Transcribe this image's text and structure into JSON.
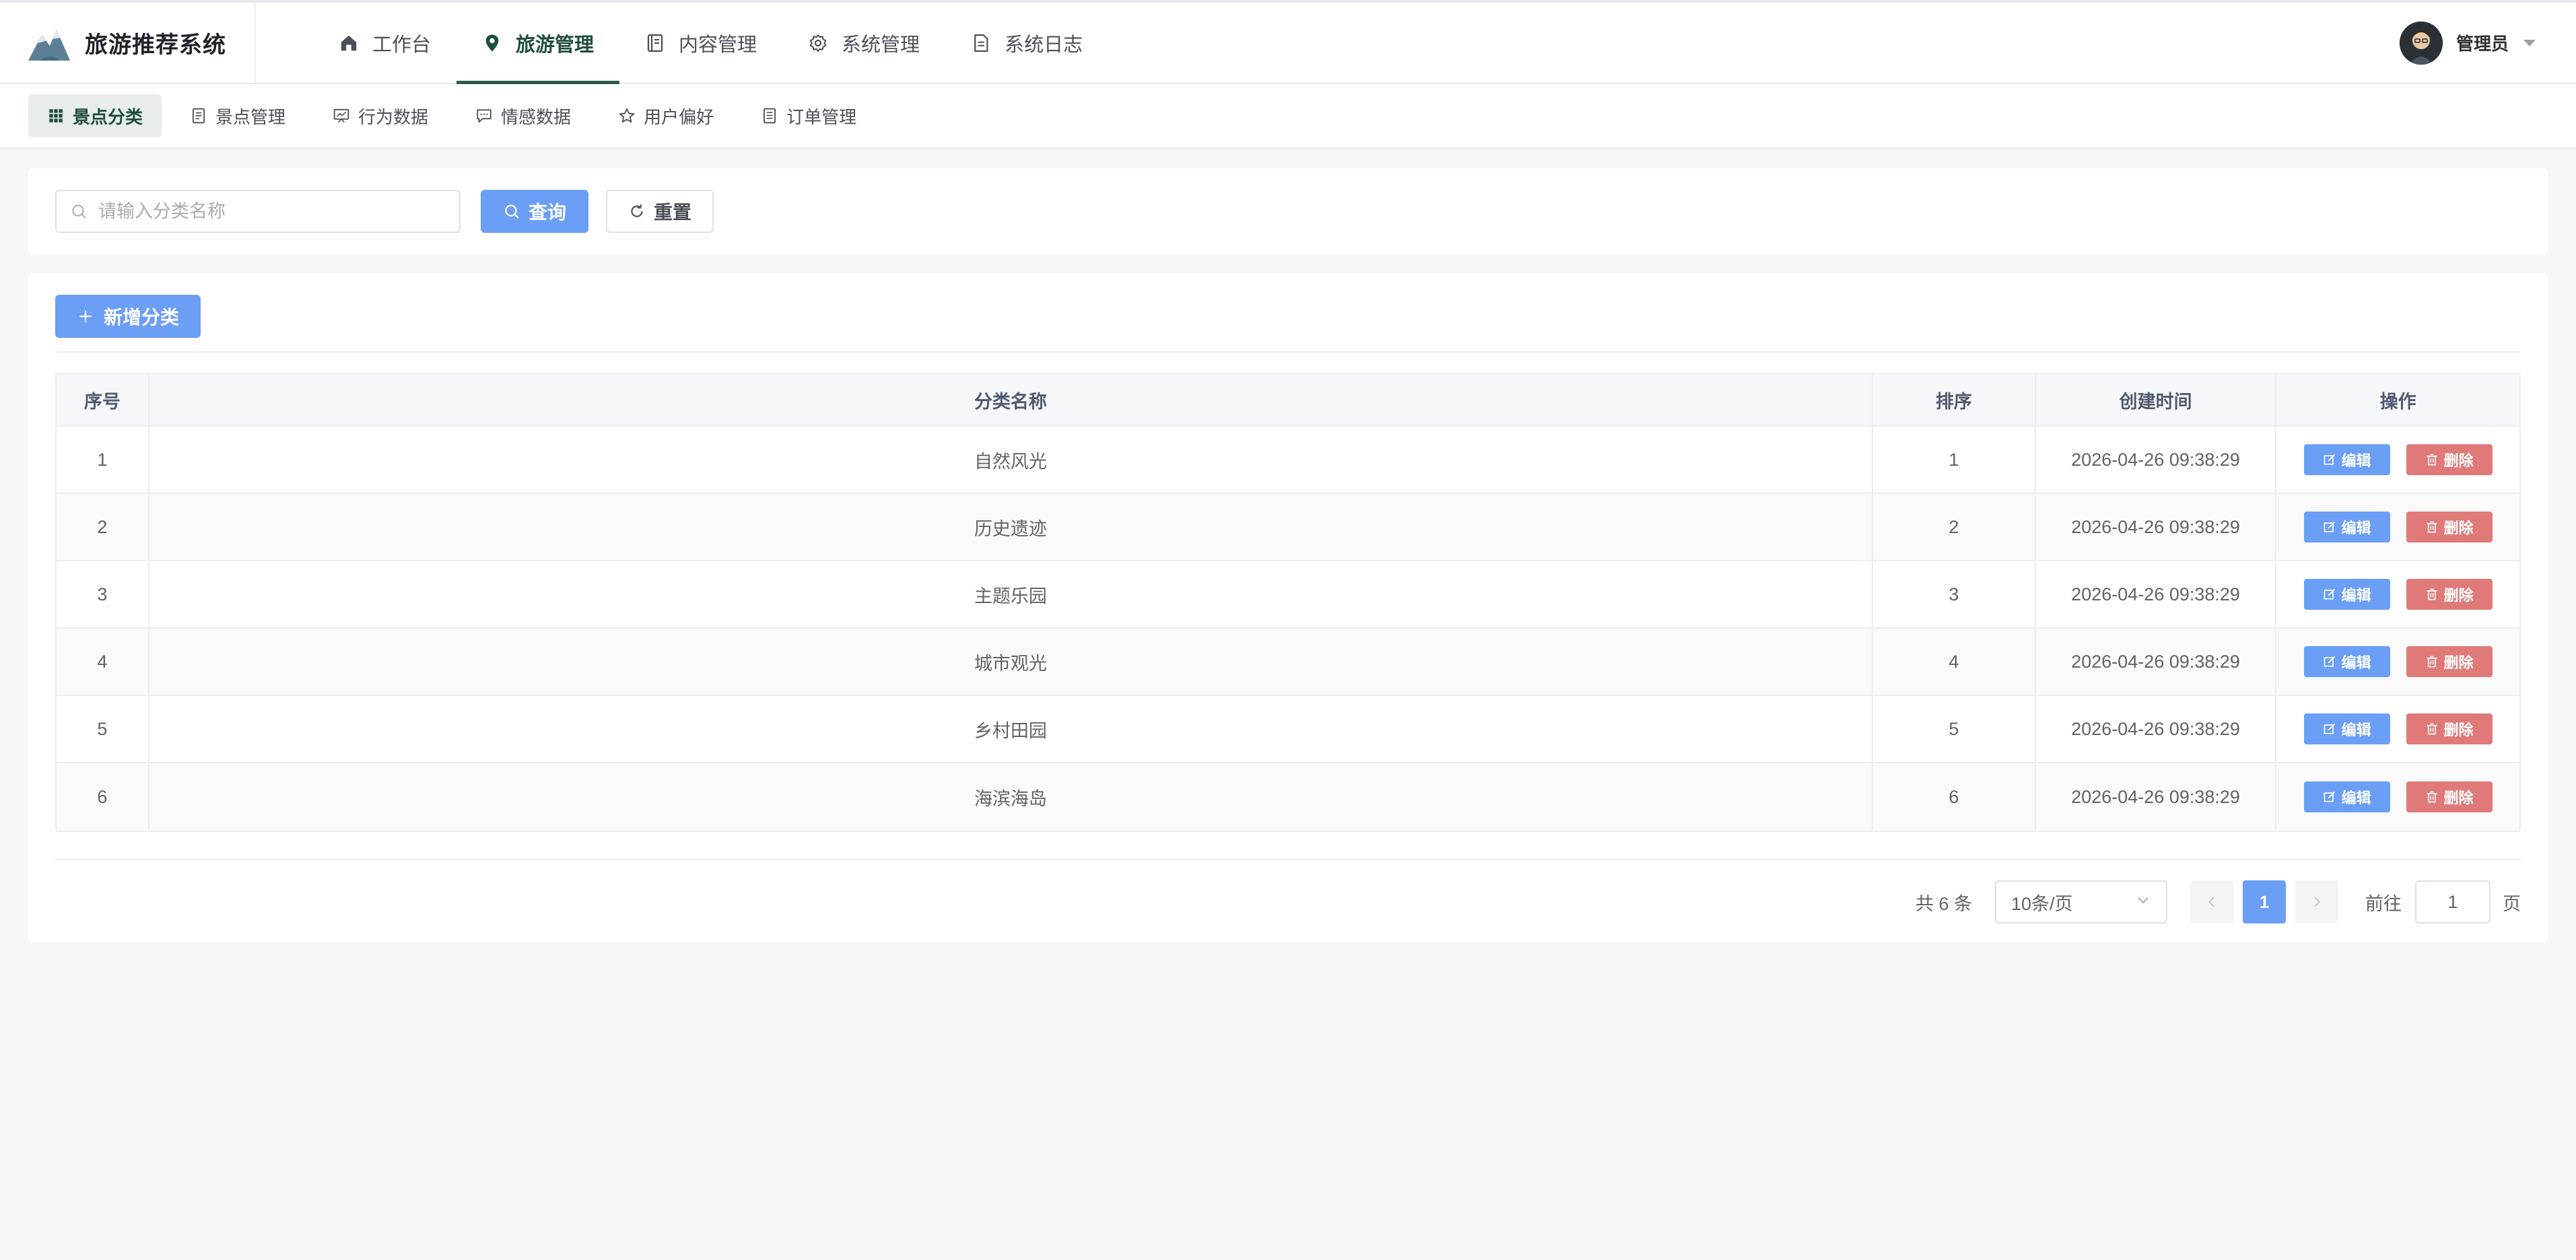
{
  "app": {
    "title": "旅游推荐系统"
  },
  "main_nav": [
    {
      "label": "工作台",
      "icon": "home-icon"
    },
    {
      "label": "旅游管理",
      "icon": "location-pin-icon",
      "active": true
    },
    {
      "label": "内容管理",
      "icon": "book-icon"
    },
    {
      "label": "系统管理",
      "icon": "gear-icon"
    },
    {
      "label": "系统日志",
      "icon": "document-icon"
    }
  ],
  "user": {
    "name": "管理员"
  },
  "sub_nav": [
    {
      "label": "景点分类",
      "icon": "grid-icon",
      "active": true
    },
    {
      "label": "景点管理",
      "icon": "list-doc-icon"
    },
    {
      "label": "行为数据",
      "icon": "chart-board-icon"
    },
    {
      "label": "情感数据",
      "icon": "chat-bubble-icon"
    },
    {
      "label": "用户偏好",
      "icon": "star-icon"
    },
    {
      "label": "订单管理",
      "icon": "order-doc-icon"
    }
  ],
  "search": {
    "placeholder": "请输入分类名称",
    "value": "",
    "query_label": "查询",
    "reset_label": "重置"
  },
  "toolbar": {
    "add_label": "新增分类"
  },
  "table": {
    "columns": [
      "序号",
      "分类名称",
      "排序",
      "创建时间",
      "操作"
    ],
    "rows": [
      {
        "idx": "1",
        "name": "自然风光",
        "sort": "1",
        "created": "2026-04-26 09:38:29"
      },
      {
        "idx": "2",
        "name": "历史遗迹",
        "sort": "2",
        "created": "2026-04-26 09:38:29"
      },
      {
        "idx": "3",
        "name": "主题乐园",
        "sort": "3",
        "created": "2026-04-26 09:38:29"
      },
      {
        "idx": "4",
        "name": "城市观光",
        "sort": "4",
        "created": "2026-04-26 09:38:29"
      },
      {
        "idx": "5",
        "name": "乡村田园",
        "sort": "5",
        "created": "2026-04-26 09:38:29"
      },
      {
        "idx": "6",
        "name": "海滨海岛",
        "sort": "6",
        "created": "2026-04-26 09:38:29"
      }
    ],
    "edit_label": "编辑",
    "delete_label": "删除"
  },
  "pagination": {
    "total_text": "共 6 条",
    "page_size": "10条/页",
    "current_page": "1",
    "goto_label": "前往",
    "goto_value": "1",
    "goto_suffix": "页"
  },
  "colors": {
    "primary": "#6b9ef5",
    "danger": "#e07a79",
    "active_nav": "#2d5a4c"
  }
}
